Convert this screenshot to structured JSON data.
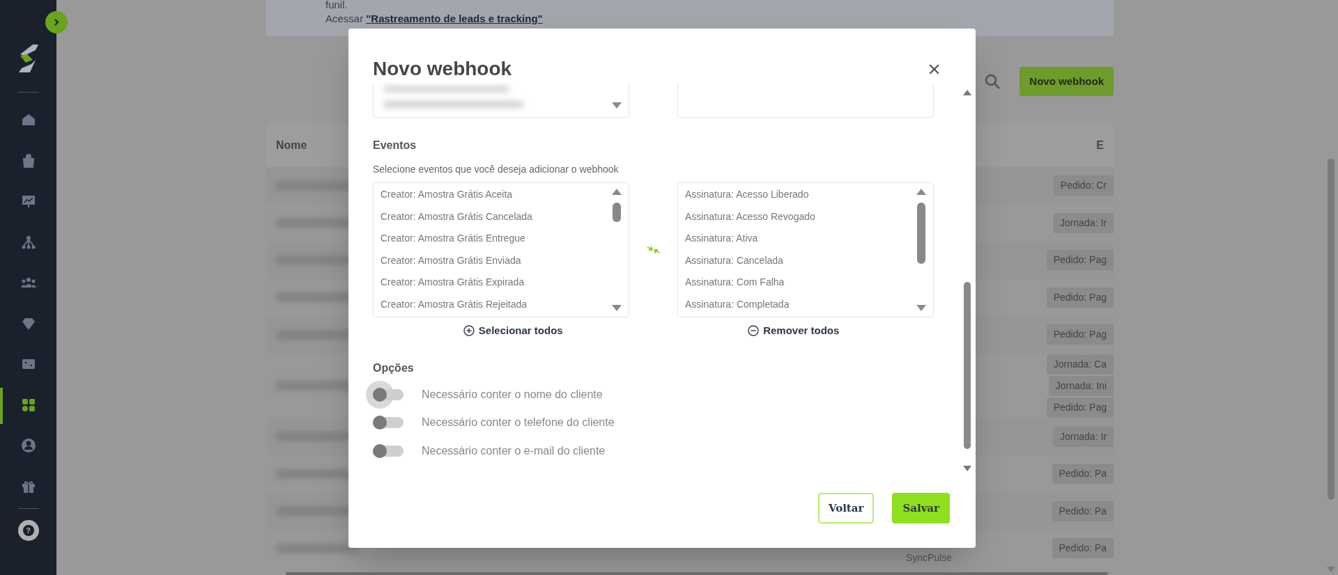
{
  "sidebar": {
    "items": [
      {
        "selected": false
      },
      {
        "selected": false
      },
      {
        "selected": false
      },
      {
        "selected": false
      },
      {
        "selected": false
      },
      {
        "selected": false
      },
      {
        "selected": false
      },
      {
        "selected": true
      },
      {
        "selected": false
      },
      {
        "selected": false
      }
    ],
    "help_icon": "?"
  },
  "banner": {
    "cut_text": "funil.",
    "prefix": "Acessar",
    "link": "\"Rastreamento de leads e tracking\""
  },
  "toolbar": {
    "new_button": "Novo webhook"
  },
  "table": {
    "columns": [
      "Nome",
      "E"
    ],
    "rows": [
      {
        "events": [
          "Pedido: Cr"
        ]
      },
      {
        "events": [
          "Jornada: Ir"
        ]
      },
      {
        "events": [
          "Pedido: Pag"
        ]
      },
      {
        "events": [
          "Pedido: Pag"
        ]
      },
      {
        "events": [
          "Pedido: Pag"
        ]
      },
      {
        "events": [
          "Jornada: Ca",
          "Jornada: Ini",
          "Pedido: Pag"
        ]
      },
      {
        "events": [
          "Jornada: Ir"
        ]
      },
      {
        "events": [
          "Pedido: Pa"
        ]
      },
      {
        "events": [
          "Pedido: Pa"
        ]
      },
      {
        "events": [
          "Pedido: Pa"
        ]
      }
    ],
    "footer_text": "SyncPulse"
  },
  "modal": {
    "title": "Novo webhook",
    "close": "×",
    "events_label": "Eventos",
    "events_hint": "Selecione eventos que você deseja adicionar o webhook",
    "available": [
      "Creator: Amostra Grátis Aceita",
      "Creator: Amostra Grátis Cancelada",
      "Creator: Amostra Grátis Entregue",
      "Creator: Amostra Grátis Enviada",
      "Creator: Amostra Grátis Expirada",
      "Creator: Amostra Grátis Rejeitada"
    ],
    "selected_events": [
      "Assinatura: Acesso Liberado",
      "Assinatura: Acesso Revogado",
      "Assinatura: Ativa",
      "Assinatura: Cancelada",
      "Assinatura: Com Falha",
      "Assinatura: Completada"
    ],
    "select_all": "Selecionar todos",
    "remove_all": "Remover todos",
    "options_label": "Opções",
    "options": [
      {
        "label": "Necessário conter o nome do cliente",
        "on": false,
        "focused": true
      },
      {
        "label": "Necessário conter o telefone do cliente",
        "on": false,
        "focused": false
      },
      {
        "label": "Necessário conter o e-mail do cliente",
        "on": false,
        "focused": false
      }
    ],
    "buttons": [
      {
        "label": "Voltar",
        "kind": "secondary"
      },
      {
        "label": "Salvar",
        "kind": "primary"
      }
    ]
  }
}
